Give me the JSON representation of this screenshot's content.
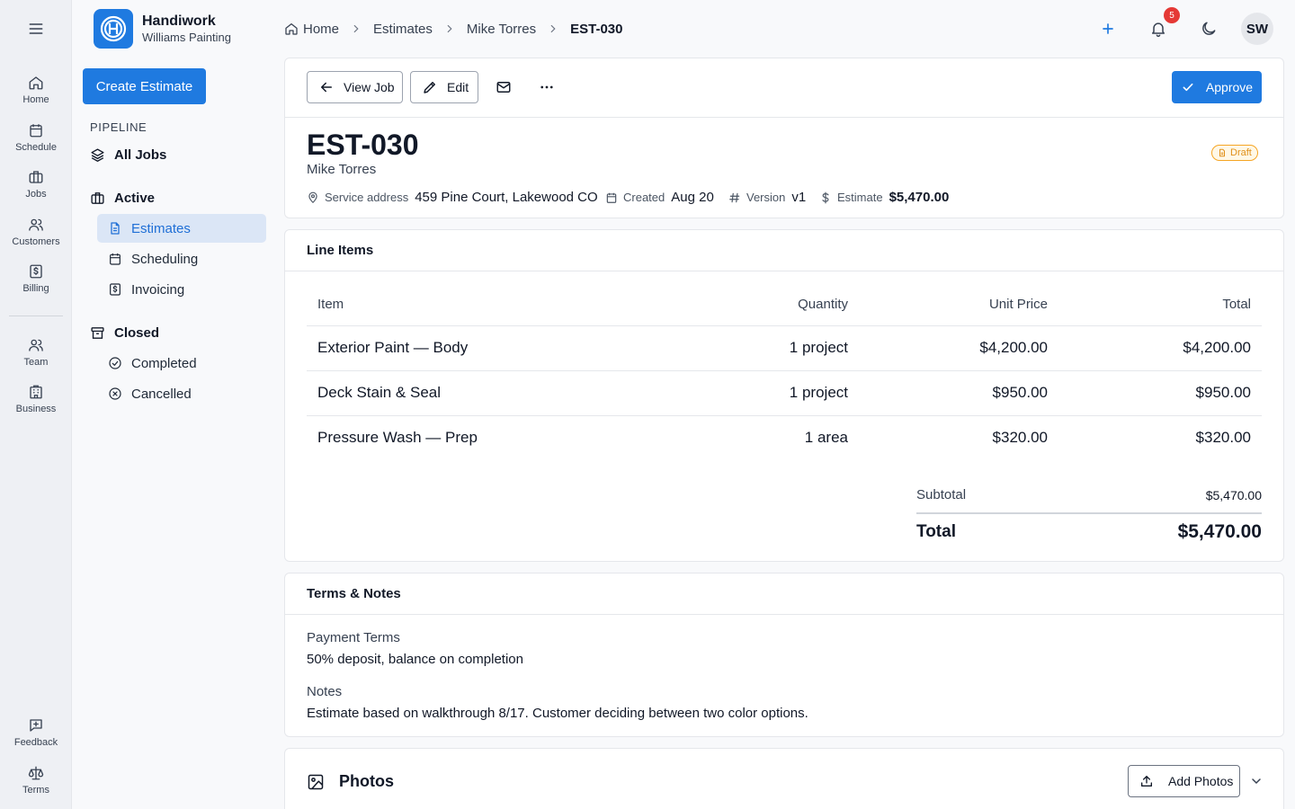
{
  "rail": {
    "items": [
      {
        "label": "Home",
        "icon": "home-icon"
      },
      {
        "label": "Schedule",
        "icon": "calendar-icon"
      },
      {
        "label": "Jobs",
        "icon": "briefcase-icon"
      },
      {
        "label": "Customers",
        "icon": "users-icon"
      },
      {
        "label": "Billing",
        "icon": "dollar-document-icon"
      },
      {
        "label": "Team",
        "icon": "team-icon"
      },
      {
        "label": "Business",
        "icon": "building-icon"
      },
      {
        "label": "Feedback",
        "icon": "message-plus-icon"
      },
      {
        "label": "Terms",
        "icon": "scale-icon"
      }
    ]
  },
  "brand": {
    "name": "Handiwork",
    "subtitle": "Williams Painting"
  },
  "sidebar": {
    "create_label": "Create Estimate",
    "section_label": "PIPELINE",
    "all_jobs": "All Jobs",
    "active": {
      "label": "Active",
      "items": [
        "Estimates",
        "Scheduling",
        "Invoicing"
      ],
      "selected": "Estimates"
    },
    "closed": {
      "label": "Closed",
      "items": [
        "Completed",
        "Cancelled"
      ]
    }
  },
  "breadcrumb": [
    "Home",
    "Estimates",
    "Mike Torres",
    "EST-030"
  ],
  "topbar": {
    "notification_count": "5",
    "avatar_initials": "SW"
  },
  "toolbar": {
    "view_job": "View Job",
    "edit": "Edit",
    "approve": "Approve"
  },
  "estimate": {
    "id": "EST-030",
    "customer": "Mike Torres",
    "status": "Draft",
    "service_address_label": "Service address",
    "service_address": "459 Pine Court, Lakewood CO",
    "created_label": "Created",
    "created": "Aug 20",
    "version_label": "Version",
    "version": "v1",
    "estimate_label": "Estimate",
    "estimate_total": "$5,470.00"
  },
  "line_items": {
    "title": "Line Items",
    "columns": [
      "Item",
      "Quantity",
      "Unit Price",
      "Total"
    ],
    "rows": [
      {
        "item": "Exterior Paint — Body",
        "quantity": "1 project",
        "unit_price": "$4,200.00",
        "total": "$4,200.00"
      },
      {
        "item": "Deck Stain & Seal",
        "quantity": "1 project",
        "unit_price": "$950.00",
        "total": "$950.00"
      },
      {
        "item": "Pressure Wash — Prep",
        "quantity": "1 area",
        "unit_price": "$320.00",
        "total": "$320.00"
      }
    ],
    "subtotal_label": "Subtotal",
    "subtotal": "$5,470.00",
    "total_label": "Total",
    "total": "$5,470.00"
  },
  "terms": {
    "title": "Terms & Notes",
    "payment_label": "Payment Terms",
    "payment_value": "50% deposit, balance on completion",
    "notes_label": "Notes",
    "notes_value": "Estimate based on walkthrough 8/17. Customer deciding between two color options."
  },
  "photos": {
    "title": "Photos",
    "add_label": "Add Photos"
  },
  "colors": {
    "accent": "#1f7ae0",
    "active_bg": "#dbe6f6",
    "draft": "#f5a524",
    "badge": "#e53935"
  }
}
